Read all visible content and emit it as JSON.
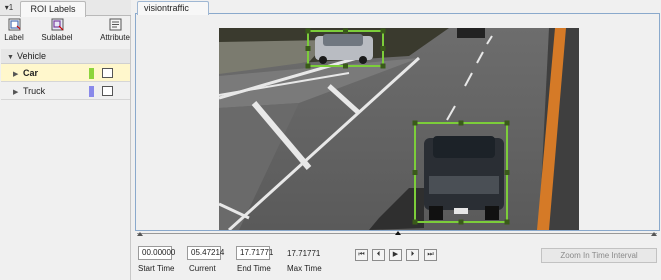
{
  "left_panel": {
    "menu_arrow": "▾1",
    "tab_label": "ROI Labels",
    "toolstrip": {
      "label": "Label",
      "sublabel": "Sublabel",
      "attribute": "Attribute"
    },
    "tree": {
      "group": "Vehicle",
      "items": [
        {
          "label": "Car",
          "color": "#8cd43c",
          "selected": true
        },
        {
          "label": "Truck",
          "color": "#8a8aea",
          "selected": false
        }
      ]
    }
  },
  "display": {
    "tab_label": "visiontraffic",
    "roi_color": "#7ccd3a"
  },
  "playback": {
    "start_time": "00.00000",
    "current": "05.47214",
    "end_time": "17.71771",
    "max_time": "17.71771",
    "captions": {
      "start": "Start Time",
      "current": "Current",
      "end": "End Time",
      "max": "Max Time"
    },
    "buttons": [
      "first-frame-icon",
      "previous-frame-icon",
      "play-icon",
      "next-frame-icon",
      "last-frame-icon"
    ],
    "zoom_label": "Zoom In Time Interval"
  }
}
